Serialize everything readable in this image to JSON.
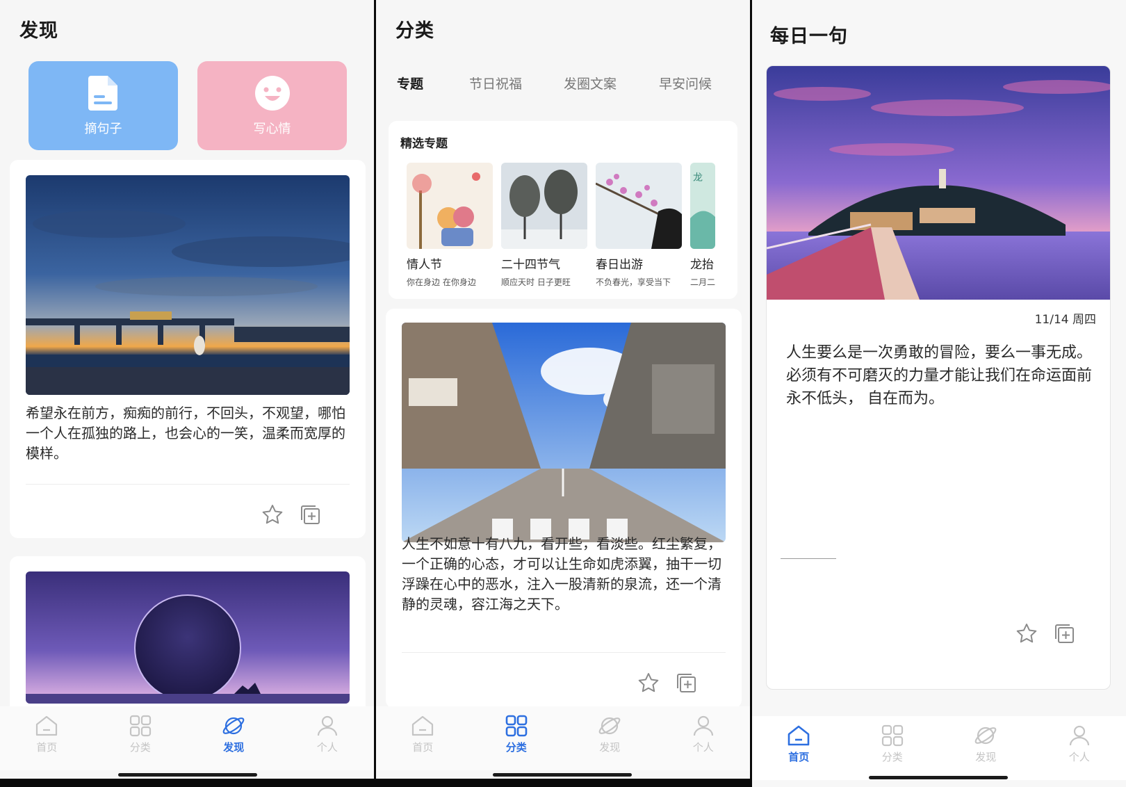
{
  "discover": {
    "title": "发现",
    "quick_actions": [
      {
        "label": "摘句子",
        "icon": "document-icon",
        "color": "#7eb7f5"
      },
      {
        "label": "写心情",
        "icon": "smiley-icon",
        "color": "#f5b3c3"
      }
    ],
    "cards": [
      {
        "text": "希望永在前方，痴痴的前行，不回头，不观望，哪怕一个人在孤独的路上，也会心的一笑，温柔而宽厚的模样。"
      }
    ]
  },
  "category": {
    "title": "分类",
    "tabs": [
      "专题",
      "节日祝福",
      "发圈文案",
      "早安问候"
    ],
    "active_tab": 0,
    "featured_title": "精选专题",
    "topics": [
      {
        "name": "情人节",
        "sub": "你在身边 在你身边"
      },
      {
        "name": "二十四节气",
        "sub": "顺应天时 日子更旺"
      },
      {
        "name": "春日出游",
        "sub": "不负春光，享受当下"
      },
      {
        "name": "龙抬",
        "sub": "二月二"
      }
    ],
    "card_text": "人生不如意十有八九，看开些，看淡些。红尘繁复，一个正确的心态，才可以让生命如虎添翼，抽干一切浮躁在心中的恶水，注入一股清新的泉流，还一个清静的灵魂，容江海之天下。"
  },
  "daily": {
    "title": "每日一句",
    "date": "11/14 周四",
    "text": "人生要么是一次勇敢的冒险，要么一事无成。必须有不可磨灭的力量才能让我们在命运面前永不低头， 自在而为。"
  },
  "nav": [
    "首页",
    "分类",
    "发现",
    "个人"
  ],
  "colors": {
    "accent": "#2d6fe0",
    "inactive": "#c4c4c4"
  }
}
